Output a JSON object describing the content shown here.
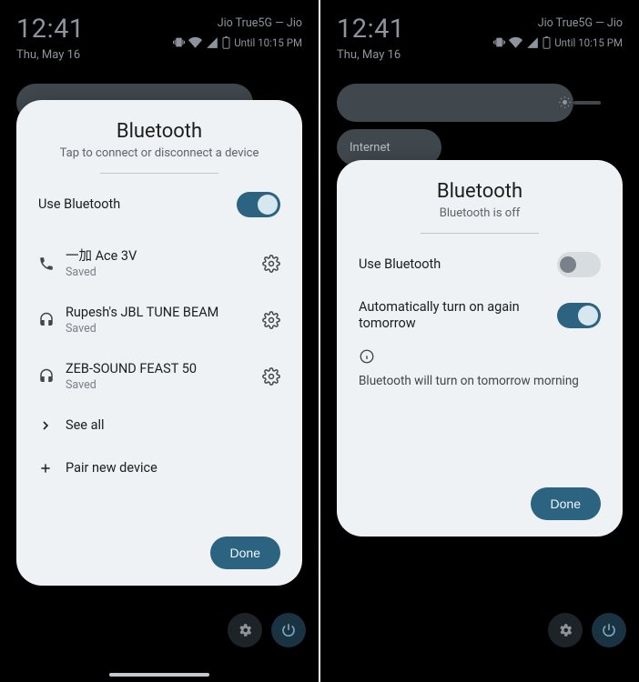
{
  "status": {
    "time": "12:41",
    "date": "Thu, May 16",
    "carrier": "Jio True5G — Jio",
    "until": "Until 10:15 PM"
  },
  "left": {
    "title": "Bluetooth",
    "subtitle": "Tap to connect or disconnect a device",
    "use_label": "Use Bluetooth",
    "use_on": true,
    "devices": [
      {
        "icon": "phone",
        "name": "一加 Ace 3V",
        "status": "Saved"
      },
      {
        "icon": "headset",
        "name": "Rupesh's JBL TUNE BEAM",
        "status": "Saved"
      },
      {
        "icon": "headset",
        "name": "ZEB-SOUND FEAST 50",
        "status": "Saved"
      }
    ],
    "see_all": "See all",
    "pair_new": "Pair new device",
    "done": "Done"
  },
  "right": {
    "qs_label": "Internet",
    "title": "Bluetooth",
    "subtitle": "Bluetooth is off",
    "use_label": "Use Bluetooth",
    "use_on": false,
    "auto_label": "Automatically turn on again tomorrow",
    "auto_on": true,
    "info_text": "Bluetooth will turn on tomorrow morning",
    "done": "Done"
  },
  "colors": {
    "accent": "#2b6381",
    "bg": "#eef2f4"
  }
}
